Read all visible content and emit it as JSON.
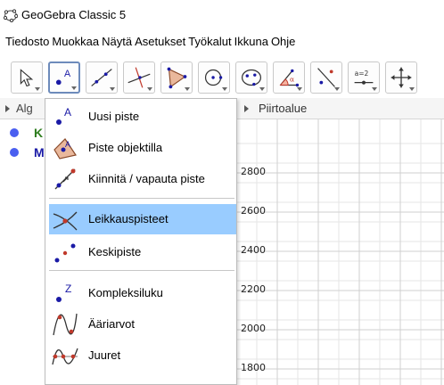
{
  "window": {
    "title": "GeoGebra Classic 5"
  },
  "menubar": {
    "items": [
      "Tiedosto",
      "Muokkaa",
      "Näytä",
      "Asetukset",
      "Työkalut",
      "Ikkuna",
      "Ohje"
    ]
  },
  "toolbar": {
    "tools": [
      {
        "icon": "move-arrow-icon"
      },
      {
        "icon": "new-point-icon"
      },
      {
        "icon": "line-icon"
      },
      {
        "icon": "perpendicular-line-icon"
      },
      {
        "icon": "polygon-icon"
      },
      {
        "icon": "circle-icon"
      },
      {
        "icon": "ellipse-icon"
      },
      {
        "icon": "angle-icon"
      },
      {
        "icon": "reflect-icon"
      },
      {
        "icon": "slider-icon",
        "text": "a=2"
      },
      {
        "icon": "move-graphics-icon"
      }
    ]
  },
  "algebra": {
    "header": "Alg",
    "rows": [
      {
        "name": "K",
        "color": "#2e7d1e"
      },
      {
        "name": "M",
        "color": "#1a1aa6"
      }
    ]
  },
  "graphics": {
    "header": "Piirtoalue",
    "y_ticks": [
      "2800",
      "2600",
      "2400",
      "2200",
      "2000",
      "1800"
    ]
  },
  "dropdown": {
    "items": [
      {
        "label": "Uusi piste",
        "icon": "new-point-icon"
      },
      {
        "label": "Piste objektilla",
        "icon": "point-on-object-icon"
      },
      {
        "label": "Kiinnitä / vapauta piste",
        "icon": "attach-detach-point-icon"
      },
      {
        "label": "Leikkauspisteet",
        "icon": "intersect-icon",
        "selected": true
      },
      {
        "label": "Keskipiste",
        "icon": "midpoint-icon"
      },
      {
        "label": "Kompleksiluku",
        "icon": "complex-number-icon"
      },
      {
        "label": "Ääriarvot",
        "icon": "extremum-icon"
      },
      {
        "label": "Juuret",
        "icon": "roots-icon"
      }
    ]
  },
  "colors": {
    "selection": "#99ccff",
    "point_blue": "#1a1aa6",
    "active_border": "#6d8bbb"
  }
}
